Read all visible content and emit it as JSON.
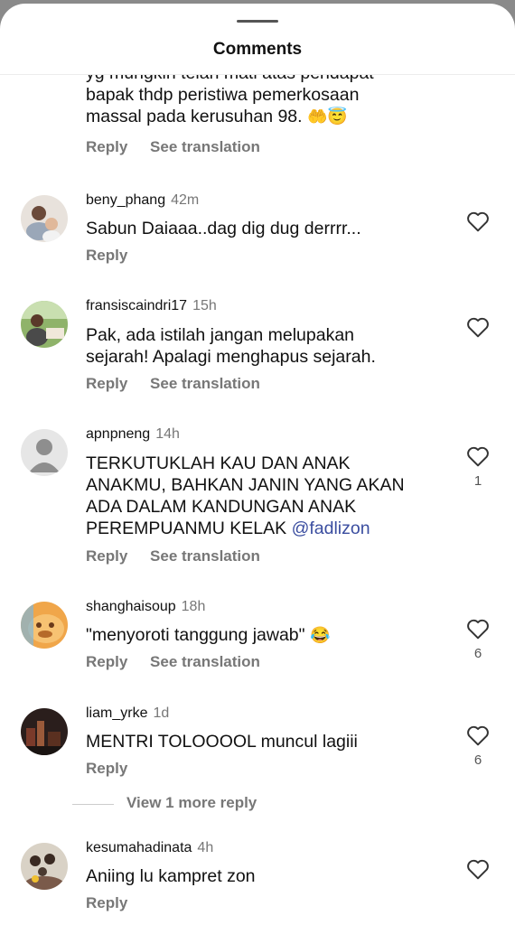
{
  "header": {
    "title": "Comments"
  },
  "partial_comment": {
    "lines": [
      "yg mungkin telah mati atas pendapat",
      "bapak thdp peristiwa pemerkosaan",
      "massal pada kerusuhan 98."
    ],
    "emojis": "🤲😇",
    "reply_label": "Reply",
    "translate_label": "See translation"
  },
  "comments": [
    {
      "username": "beny_phang",
      "time": "42m",
      "lines": [
        "Sabun Daiaaa..dag dig dug derrrr..."
      ],
      "reply_label": "Reply",
      "likes": ""
    },
    {
      "username": "fransiscaindri17",
      "time": "15h",
      "lines": [
        "Pak, ada istilah jangan melupakan",
        "sejarah! Apalagi menghapus sejarah."
      ],
      "reply_label": "Reply",
      "translate_label": "See translation",
      "likes": ""
    },
    {
      "username": "apnpneng",
      "time": "14h",
      "lines": [
        "TERKUTUKLAH KAU DAN ANAK",
        "ANAKMU, BAHKAN JANIN YANG AKAN",
        "ADA DALAM KANDUNGAN ANAK",
        "PEREMPUANMU KELAK"
      ],
      "mention": "@fadlizon",
      "reply_label": "Reply",
      "translate_label": "See translation",
      "likes": "1"
    },
    {
      "username": "shanghaisoup",
      "time": "18h",
      "lines": [
        "\"menyoroti tanggung jawab\""
      ],
      "emoji": "😂",
      "reply_label": "Reply",
      "translate_label": "See translation",
      "likes": "6"
    },
    {
      "username": "liam_yrke",
      "time": "1d",
      "lines": [
        "MENTRI TOLOOOOL muncul lagiii"
      ],
      "reply_label": "Reply",
      "likes": "6",
      "view_more": "View 1 more reply"
    },
    {
      "username": "kesumahadinata",
      "time": "4h",
      "lines": [
        "Aniing lu kampret zon"
      ],
      "reply_label": "Reply",
      "likes": ""
    }
  ]
}
